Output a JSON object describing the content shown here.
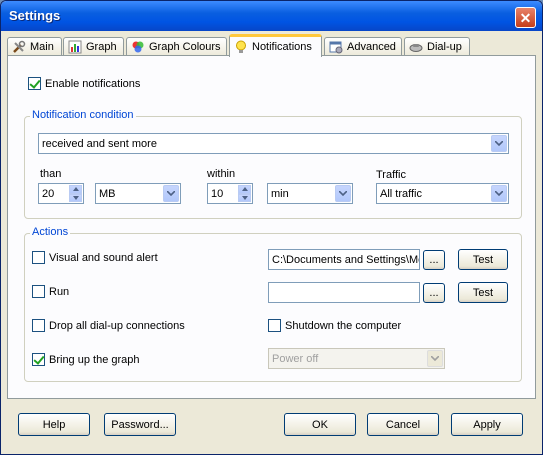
{
  "window": {
    "title": "Settings",
    "close_label": "✕"
  },
  "tabs": [
    {
      "label": "Main",
      "icon": "tools-icon"
    },
    {
      "label": "Graph",
      "icon": "bar-chart-icon"
    },
    {
      "label": "Graph Colours",
      "icon": "palette-icon"
    },
    {
      "label": "Notifications",
      "icon": "lightbulb-icon",
      "active": true
    },
    {
      "label": "Advanced",
      "icon": "settings-window-icon"
    },
    {
      "label": "Dial-up",
      "icon": "phone-icon"
    }
  ],
  "enable_notifications": {
    "label": "Enable notifications",
    "checked": true
  },
  "condition": {
    "legend": "Notification condition",
    "mode_value": "received and sent more",
    "than_label": "than",
    "amount_value": "20",
    "unit_value": "MB",
    "within_label": "within",
    "period_value": "10",
    "period_unit_value": "min",
    "traffic_label": "Traffic",
    "traffic_value": "All traffic"
  },
  "actions": {
    "legend": "Actions",
    "visual_alert": {
      "label": "Visual and sound alert",
      "checked": false,
      "path_value": "C:\\Documents and Settings\\Me",
      "browse_label": "...",
      "test_label": "Test"
    },
    "run": {
      "label": "Run",
      "checked": false,
      "path_value": "",
      "browse_label": "...",
      "test_label": "Test"
    },
    "drop_dialup": {
      "label": "Drop all dial-up connections",
      "checked": false
    },
    "shutdown": {
      "label": "Shutdown the computer",
      "checked": false
    },
    "bring_graph": {
      "label": "Bring up the graph",
      "checked": true
    },
    "power_value": "Power off"
  },
  "buttons": {
    "help": "Help",
    "password": "Password...",
    "ok": "OK",
    "cancel": "Cancel",
    "apply": "Apply"
  }
}
